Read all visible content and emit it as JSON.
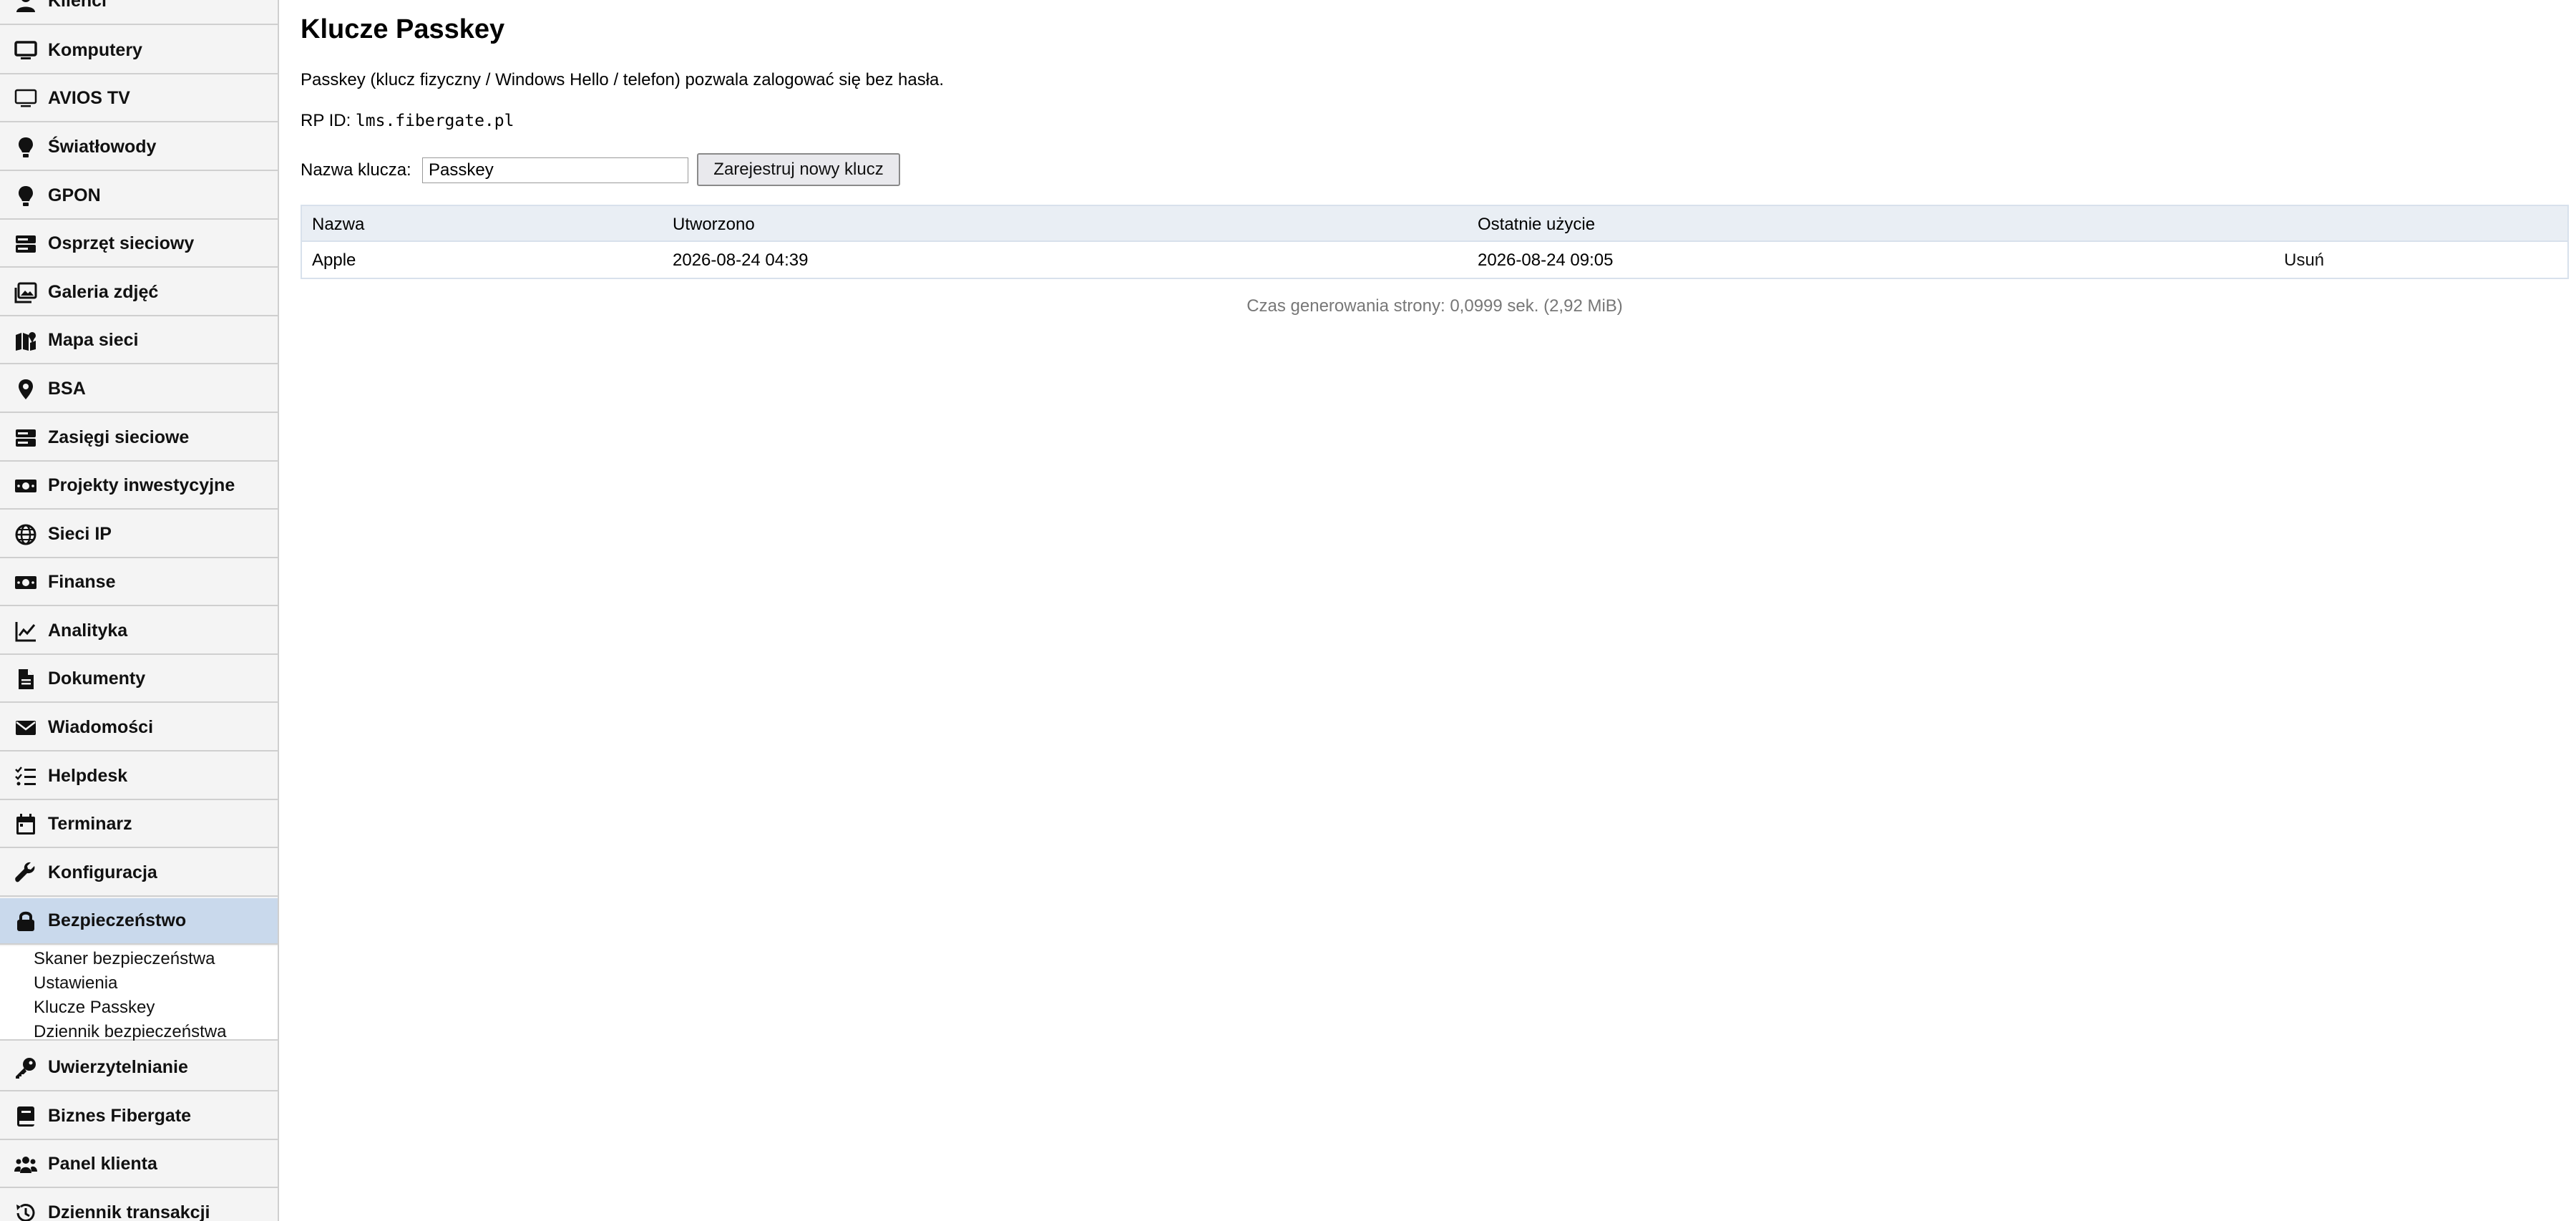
{
  "sidebar": {
    "items": [
      {
        "label": "Klienci",
        "icon": "user-icon"
      },
      {
        "label": "Komputery",
        "icon": "monitor-icon"
      },
      {
        "label": "AVIOS TV",
        "icon": "tv-icon"
      },
      {
        "label": "Światłowody",
        "icon": "lightbulb-icon"
      },
      {
        "label": "GPON",
        "icon": "lightbulb-icon"
      },
      {
        "label": "Osprzęt sieciowy",
        "icon": "server-icon"
      },
      {
        "label": "Galeria zdjęć",
        "icon": "images-icon"
      },
      {
        "label": "Mapa sieci",
        "icon": "map-icon"
      },
      {
        "label": "BSA",
        "icon": "map-marker-icon"
      },
      {
        "label": "Zasięgi sieciowe",
        "icon": "server-icon"
      },
      {
        "label": "Projekty inwestycyjne",
        "icon": "money-icon"
      },
      {
        "label": "Sieci IP",
        "icon": "globe-icon"
      },
      {
        "label": "Finanse",
        "icon": "money-icon"
      },
      {
        "label": "Analityka",
        "icon": "chart-line-icon"
      },
      {
        "label": "Dokumenty",
        "icon": "file-icon"
      },
      {
        "label": "Wiadomości",
        "icon": "envelope-icon"
      },
      {
        "label": "Helpdesk",
        "icon": "list-check-icon"
      },
      {
        "label": "Terminarz",
        "icon": "calendar-icon"
      },
      {
        "label": "Konfiguracja",
        "icon": "wrench-icon"
      },
      {
        "label": "Bezpieczeństwo",
        "icon": "lock-icon"
      },
      {
        "label": "Uwierzytelnianie",
        "icon": "key-icon"
      },
      {
        "label": "Biznes Fibergate",
        "icon": "book-icon"
      },
      {
        "label": "Panel klienta",
        "icon": "users-icon"
      },
      {
        "label": "Dziennik transakcji",
        "icon": "history-icon"
      }
    ],
    "submenu": [
      "Skaner bezpieczeństwa",
      "Ustawienia",
      "Klucze Passkey",
      "Dziennik bezpieczeństwa"
    ]
  },
  "main": {
    "title": "Klucze Passkey",
    "description": "Passkey (klucz fizyczny / Windows Hello / telefon) pozwala zalogować się bez hasła.",
    "rp_label": "RP ID:",
    "rp_value": "lms.fibergate.pl",
    "key_label": "Nazwa klucza:",
    "key_value": "Passkey",
    "register_label": "Zarejestruj nowy klucz",
    "table": {
      "headers": [
        "Nazwa",
        "Utworzono",
        "Ostatnie użycie"
      ],
      "rows": [
        {
          "name": "Apple",
          "created": "2026-08-24 04:39",
          "last_used": "2026-08-24 09:05",
          "action": "Usuń"
        }
      ]
    },
    "footer": "Czas generowania strony: 0,0999 sek. (2,92 MiB)"
  }
}
